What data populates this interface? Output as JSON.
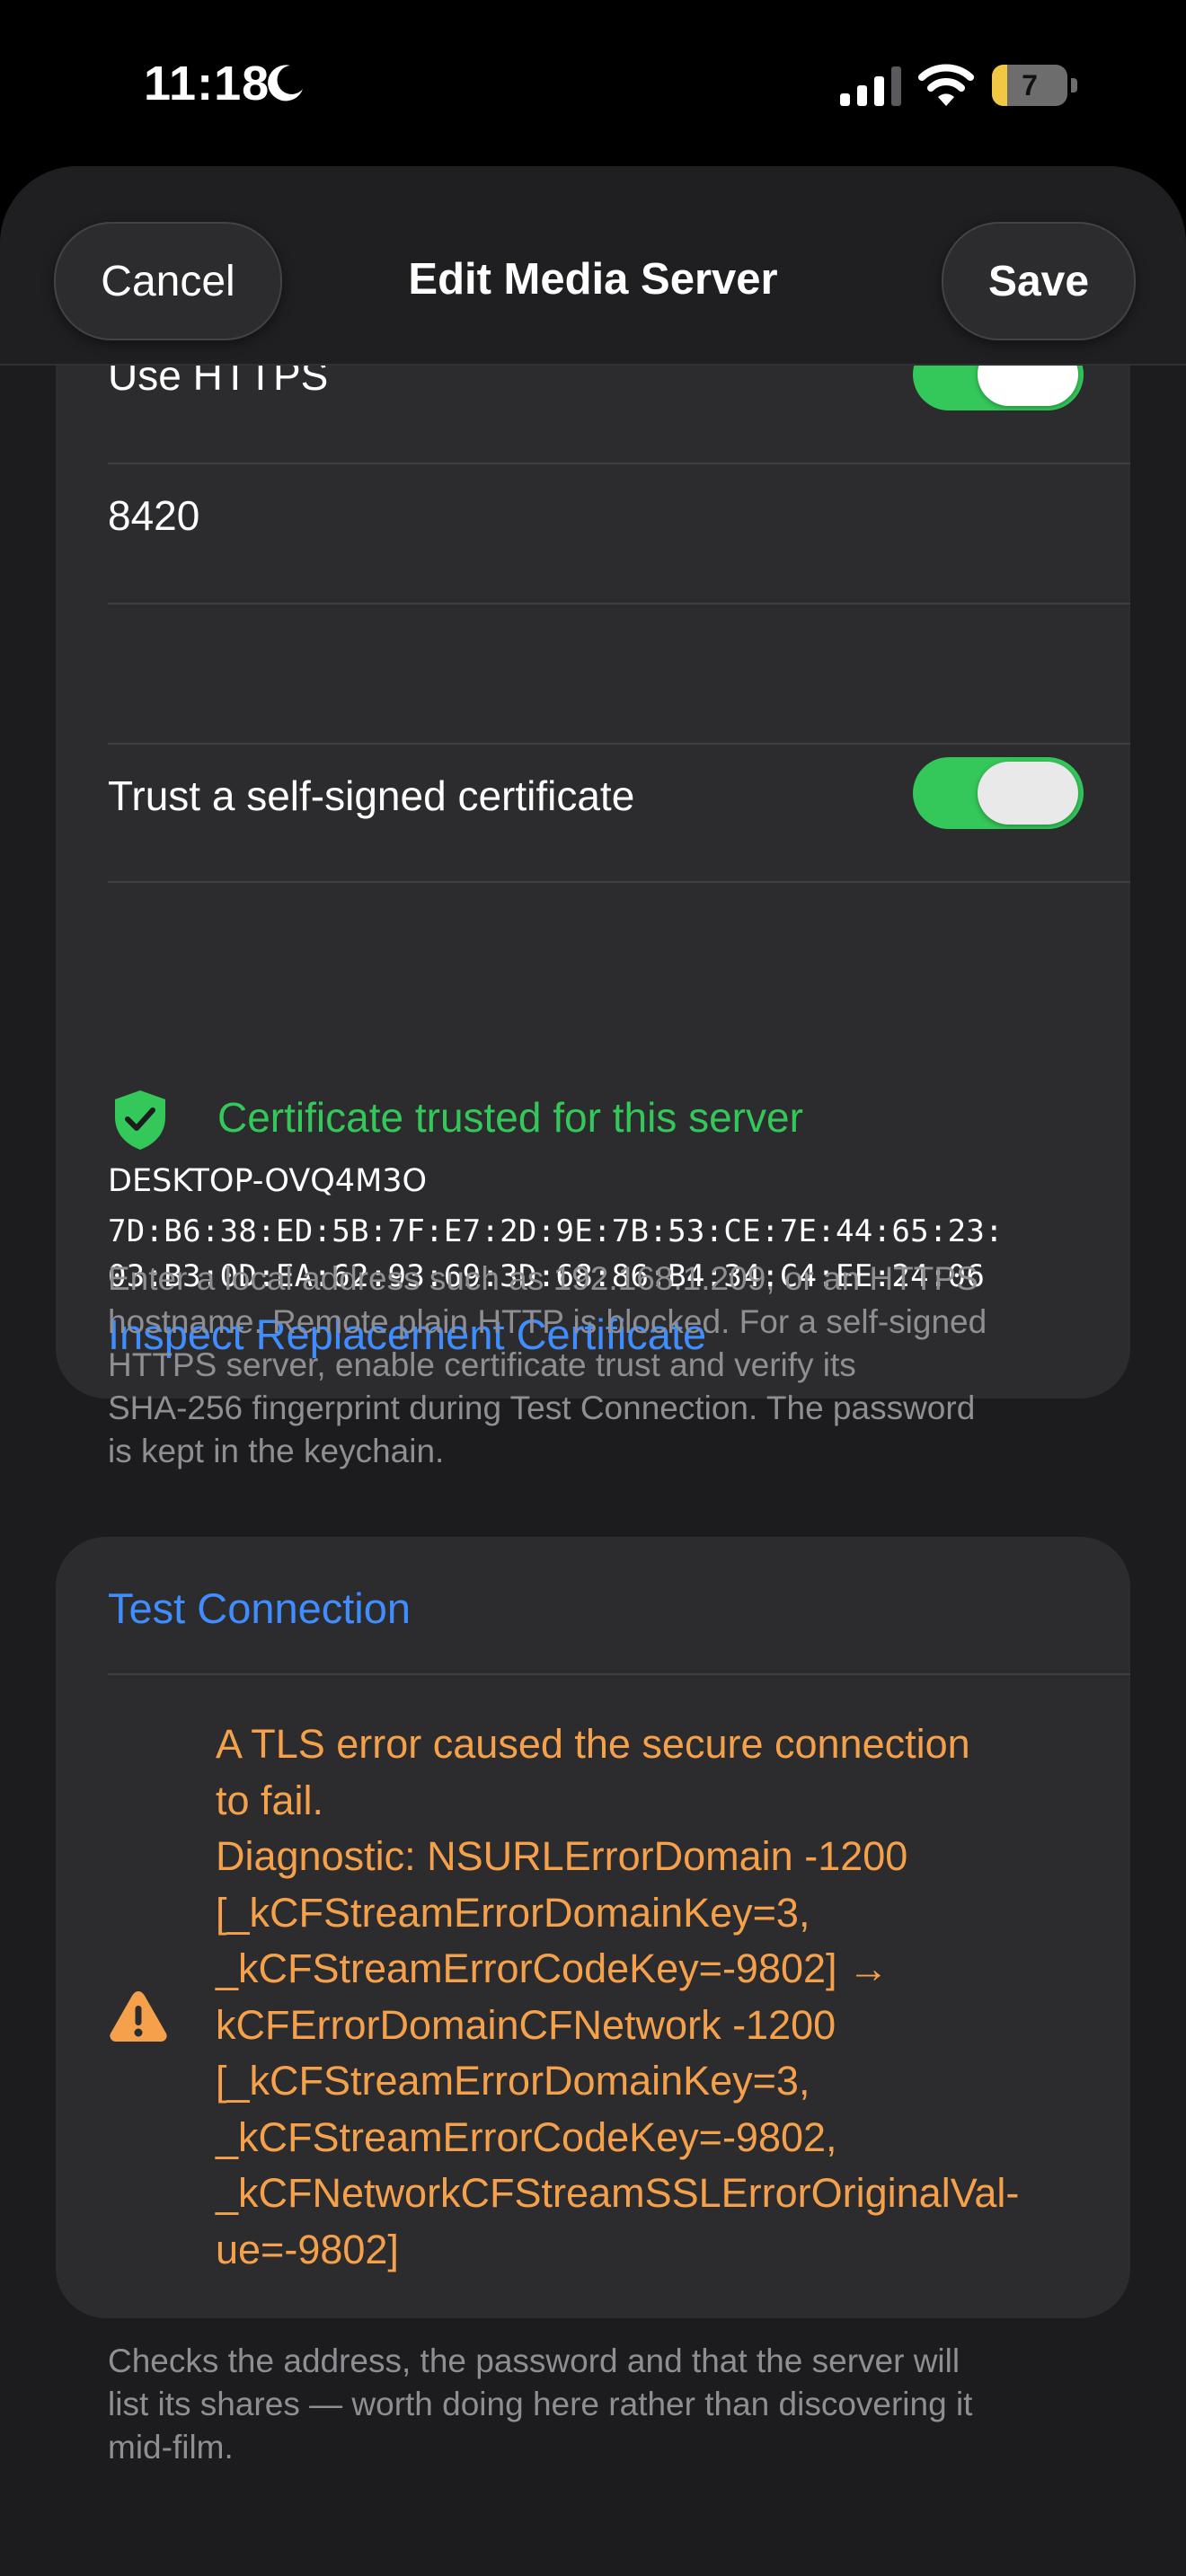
{
  "status_bar": {
    "time": "11:18",
    "focus_icon": "moon-icon",
    "battery_level": "7",
    "battery_fraction": 0.07,
    "colors": {
      "battery_fill": "#f2c744"
    }
  },
  "nav": {
    "cancel_label": "Cancel",
    "title": "Edit Media Server",
    "save_label": "Save"
  },
  "form": {
    "use_https": {
      "label": "Use HTTPS",
      "on": true
    },
    "port_value": "8420",
    "empty_field_value": "",
    "trust_self_signed": {
      "label": "Trust a self-signed certificate",
      "on": true
    },
    "certificate": {
      "status": "Certificate trusted for this server",
      "hostname": "DESKTOP-OVQ4M3O",
      "fingerprint_line1": "7D:B6:38:ED:5B:7F:E7:2D:9E:7B:53:CE:7E:44:65:23:",
      "fingerprint_line2": "03:B3:0D:EA:62:93:69:3D:68:86:B4:34:C4:EE:24:06",
      "inspect_label": "Inspect Replacement Certificate"
    },
    "footer_lines": [
      "Enter a local address such as 192.168.1.209, or an HTTPS",
      "hostname. Remote plain HTTP is blocked. For a self-signed",
      "HTTPS server, enable certificate trust and verify its",
      "SHA-256 fingerprint during Test Connection. The password",
      "is kept in the keychain."
    ]
  },
  "test": {
    "button_label": "Test Connection",
    "error_lines": [
      "A TLS error caused the secure connection",
      "to fail.",
      "Diagnostic: NSURLErrorDomain -1200",
      "[_kCFStreamErrorDomainKey=3,",
      "_kCFStreamErrorCodeKey=-9802] →",
      "kCFErrorDomainCFNetwork -1200",
      "[_kCFStreamErrorDomainKey=3,",
      "_kCFStreamErrorCodeKey=-9802,",
      "_kCFNetworkCFStreamSSLErrorOriginalVal-",
      "ue=-9802]"
    ],
    "footer_lines": [
      "Checks the address, the password and that the server will",
      "list its shares — worth doing here rather than discovering it",
      "mid-film."
    ],
    "colors": {
      "error": "#f5a14b"
    }
  },
  "colors": {
    "accent": "#3f8dff",
    "success": "#34c759",
    "sheet": "#1c1c1e",
    "card": "#2c2c2e"
  }
}
